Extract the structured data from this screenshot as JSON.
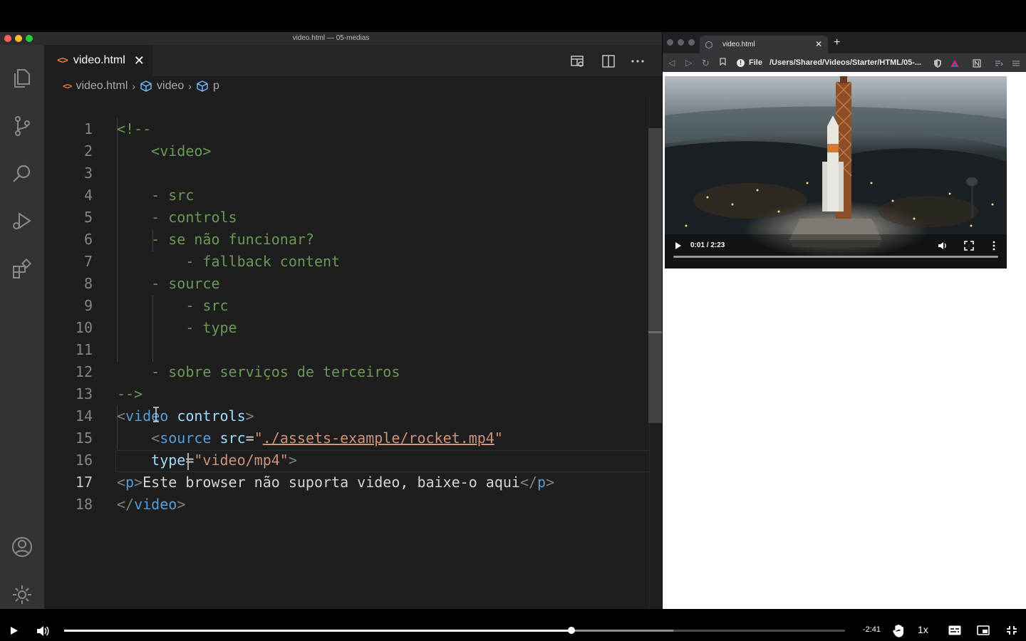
{
  "vscode": {
    "window_title": "video.html — 05-medias",
    "tab": {
      "label": "video.html",
      "close": "✕"
    },
    "breadcrumb": [
      "video.html",
      "video",
      "p"
    ],
    "lines": [
      {
        "n": "1",
        "segs": [
          {
            "t": "<!--",
            "c": "c-com"
          }
        ]
      },
      {
        "n": "2",
        "segs": [
          {
            "t": "    <video>",
            "c": "c-com"
          }
        ]
      },
      {
        "n": "3",
        "segs": []
      },
      {
        "n": "4",
        "segs": [
          {
            "t": "    - src",
            "c": "c-com"
          }
        ]
      },
      {
        "n": "5",
        "segs": [
          {
            "t": "    - controls",
            "c": "c-com"
          }
        ]
      },
      {
        "n": "6",
        "segs": [
          {
            "t": "    - se não funcionar?",
            "c": "c-com"
          }
        ]
      },
      {
        "n": "7",
        "segs": [
          {
            "t": "        - fallback content",
            "c": "c-com"
          }
        ]
      },
      {
        "n": "8",
        "segs": [
          {
            "t": "    - source",
            "c": "c-com"
          }
        ]
      },
      {
        "n": "9",
        "segs": [
          {
            "t": "        - src",
            "c": "c-com"
          }
        ]
      },
      {
        "n": "10",
        "segs": [
          {
            "t": "        - type",
            "c": "c-com"
          }
        ]
      },
      {
        "n": "11",
        "segs": []
      },
      {
        "n": "12",
        "segs": [
          {
            "t": "    - sobre serviços de terceiros",
            "c": "c-com"
          }
        ]
      },
      {
        "n": "13",
        "segs": [
          {
            "t": "-->",
            "c": "c-com"
          }
        ]
      },
      {
        "n": "14",
        "segs": [
          {
            "t": "<",
            "c": "c-punc"
          },
          {
            "t": "video",
            "c": "c-tag"
          },
          {
            "t": " ",
            "c": "c-txt"
          },
          {
            "t": "controls",
            "c": "c-attr"
          },
          {
            "t": ">",
            "c": "c-punc"
          }
        ]
      },
      {
        "n": "15",
        "segs": [
          {
            "t": "    <",
            "c": "c-punc"
          },
          {
            "t": "source",
            "c": "c-tag"
          },
          {
            "t": " ",
            "c": "c-txt"
          },
          {
            "t": "src",
            "c": "c-attr"
          },
          {
            "t": "=",
            "c": "c-txt"
          },
          {
            "t": "\"",
            "c": "c-str"
          },
          {
            "t": "./assets-example/rocket.mp4",
            "c": "c-url"
          },
          {
            "t": "\"",
            "c": "c-str"
          }
        ]
      },
      {
        "n": "16",
        "segs": [
          {
            "t": "    ",
            "c": "c-txt"
          },
          {
            "t": "type",
            "c": "c-attr"
          },
          {
            "t": "=",
            "c": "c-txt"
          },
          {
            "t": "\"video/mp4\"",
            "c": "c-str"
          },
          {
            "t": ">",
            "c": "c-punc"
          }
        ]
      },
      {
        "n": "17",
        "segs": [
          {
            "t": "<",
            "c": "c-punc"
          },
          {
            "t": "p",
            "c": "c-tag"
          },
          {
            "t": ">",
            "c": "c-punc"
          },
          {
            "t": "Este browser não suporta video, baixe-o aqui",
            "c": "c-txt"
          },
          {
            "t": "</",
            "c": "c-punc"
          },
          {
            "t": "p",
            "c": "c-tag"
          },
          {
            "t": ">",
            "c": "c-punc"
          }
        ]
      },
      {
        "n": "18",
        "segs": [
          {
            "t": "</",
            "c": "c-punc"
          },
          {
            "t": "video",
            "c": "c-tag"
          },
          {
            "t": ">",
            "c": "c-punc"
          }
        ]
      }
    ],
    "current_line": "17"
  },
  "browser": {
    "tab_title": "video.html",
    "tab_close": "✕",
    "new_tab": "+",
    "scheme_label": "File",
    "url": "/Users/Shared/Videos/Starter/HTML/05-...",
    "video": {
      "time": "0:01 / 2:23",
      "progress": 0.01
    }
  },
  "player": {
    "remaining": "-2:41",
    "speed": "1x",
    "progress": 0.65,
    "buffered": 0.78
  },
  "colors": {
    "editor_bg": "#1e1e1e",
    "activity_bar": "#333333",
    "comment": "#6a9955",
    "tag": "#569cd6",
    "attribute": "#9cdcfe",
    "string": "#ce9178"
  }
}
